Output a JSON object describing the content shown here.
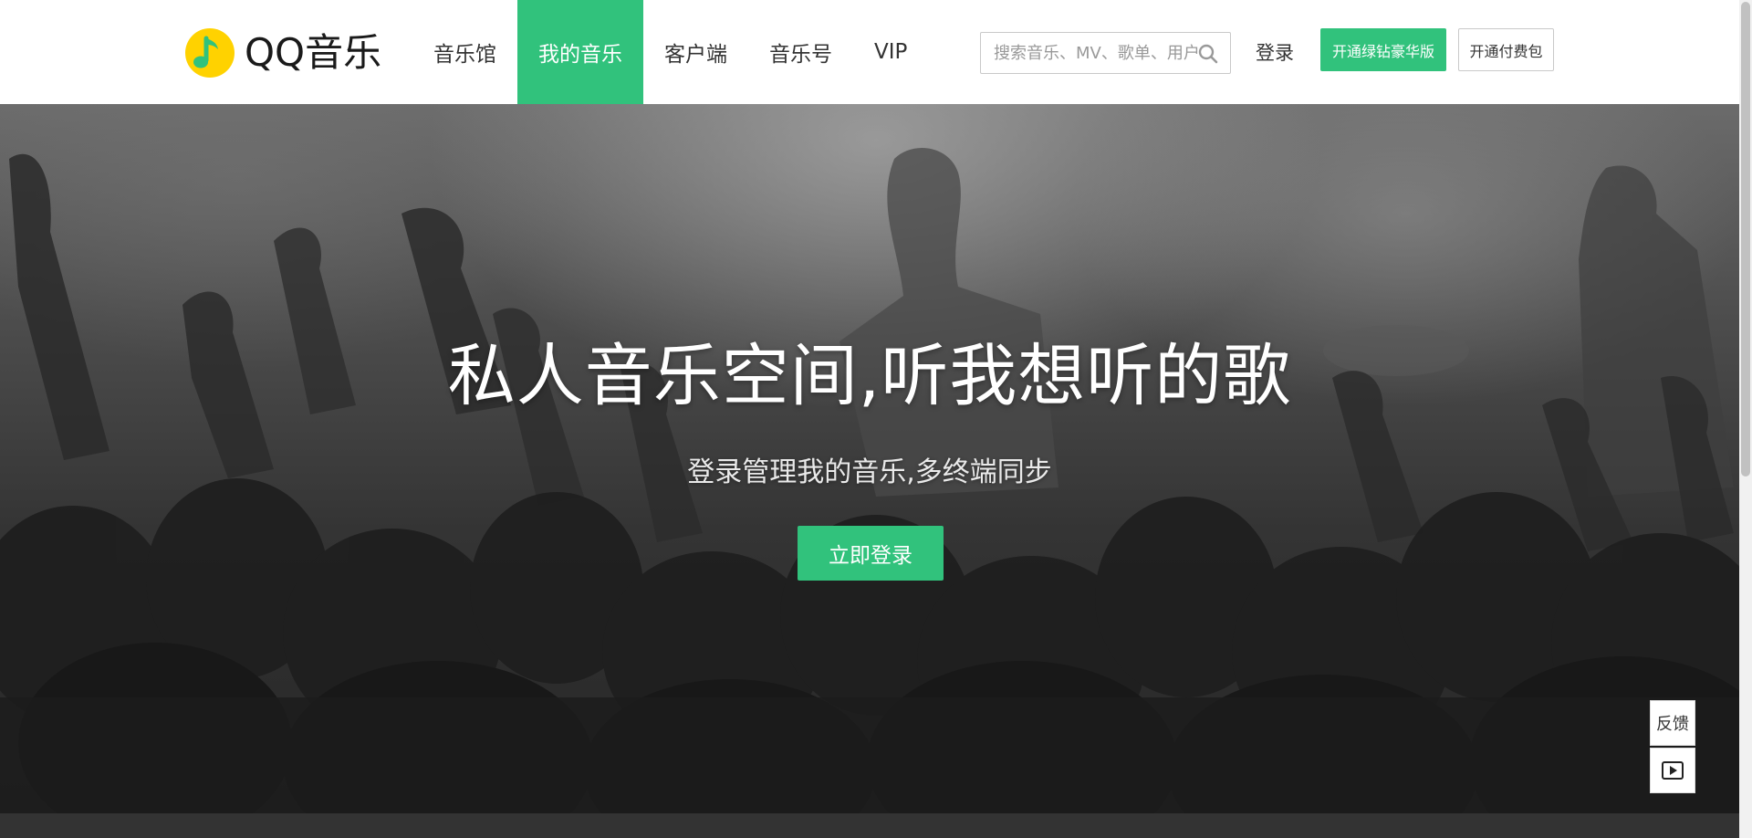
{
  "header": {
    "logo_text": "QQ音乐",
    "nav": [
      {
        "label": "音乐馆",
        "active": false
      },
      {
        "label": "我的音乐",
        "active": true
      },
      {
        "label": "客户端",
        "active": false
      },
      {
        "label": "音乐号",
        "active": false
      },
      {
        "label": "VIP",
        "active": false
      }
    ],
    "search": {
      "placeholder": "搜索音乐、MV、歌单、用户",
      "value": ""
    },
    "login_label": "登录",
    "vip_button_label": "开通绿钻豪华版",
    "pay_button_label": "开通付费包"
  },
  "hero": {
    "title": "私人音乐空间,听我想听的歌",
    "subtitle": "登录管理我的音乐,多终端同步",
    "login_button_label": "立即登录"
  },
  "side_tools": {
    "feedback_label": "反馈",
    "play_icon": "play-icon"
  },
  "colors": {
    "accent": "#31c27c",
    "logo_yellow": "#ffd200",
    "footer": "#333333"
  }
}
